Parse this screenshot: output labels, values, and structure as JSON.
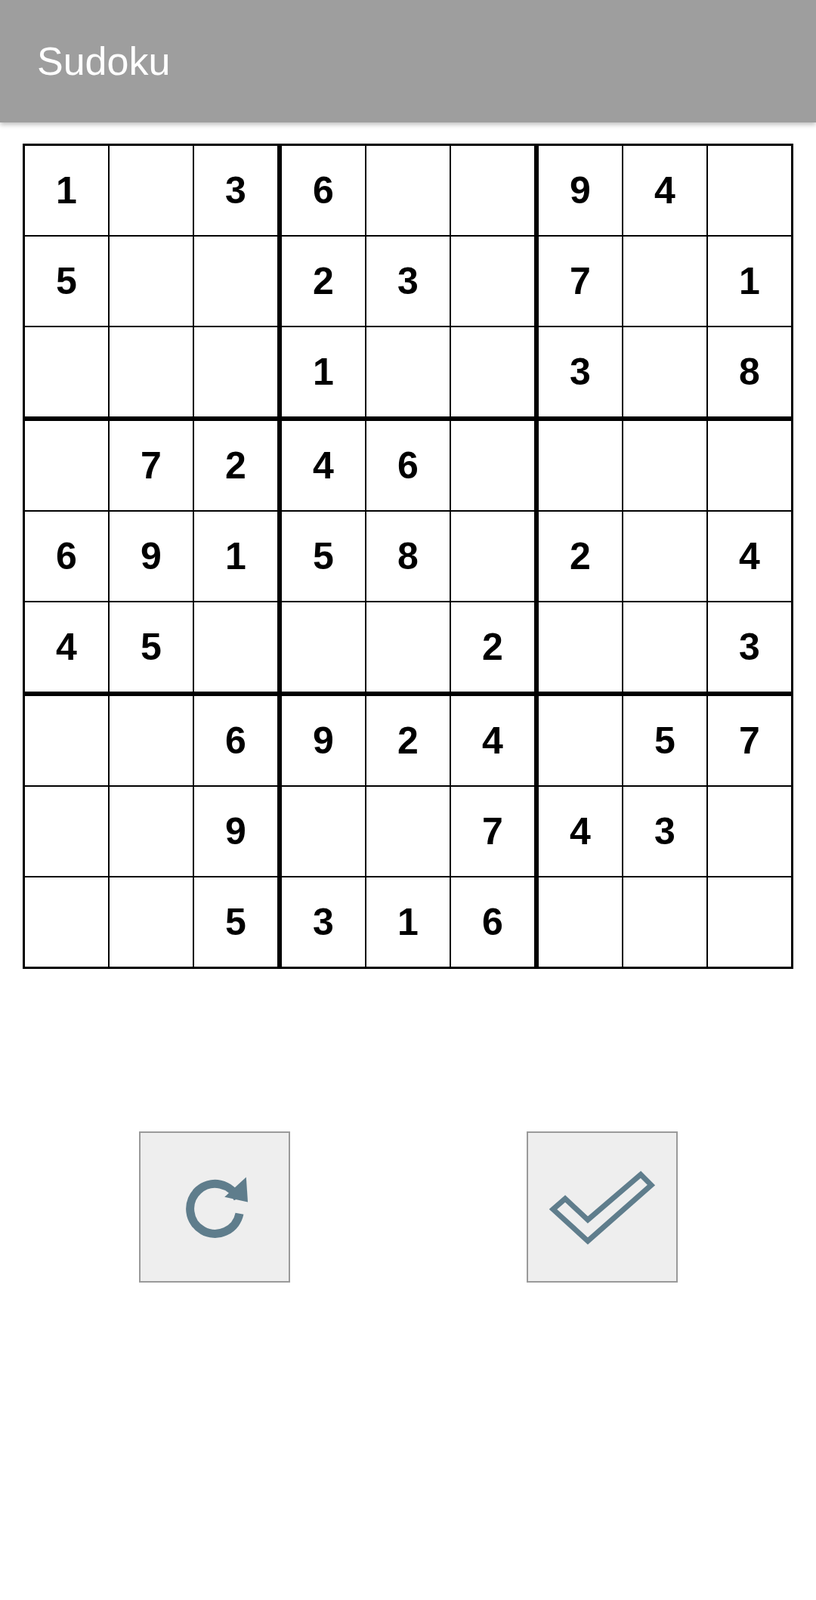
{
  "window": {
    "title": "Sudoku"
  },
  "grid": [
    [
      "1",
      "",
      "3",
      "6",
      "",
      "",
      "9",
      "4",
      ""
    ],
    [
      "5",
      "",
      "",
      "2",
      "3",
      "",
      "7",
      "",
      "1"
    ],
    [
      "",
      "",
      "",
      "1",
      "",
      "",
      "3",
      "",
      "8"
    ],
    [
      "",
      "7",
      "2",
      "4",
      "6",
      "",
      "",
      "",
      ""
    ],
    [
      "6",
      "9",
      "1",
      "5",
      "8",
      "",
      "2",
      "",
      "4"
    ],
    [
      "4",
      "5",
      "",
      "",
      "",
      "2",
      "",
      "",
      "3"
    ],
    [
      "",
      "",
      "6",
      "9",
      "2",
      "4",
      "",
      "5",
      "7"
    ],
    [
      "",
      "",
      "9",
      "",
      "",
      "7",
      "4",
      "3",
      ""
    ],
    [
      "",
      "",
      "5",
      "3",
      "1",
      "6",
      "",
      "",
      ""
    ]
  ]
}
